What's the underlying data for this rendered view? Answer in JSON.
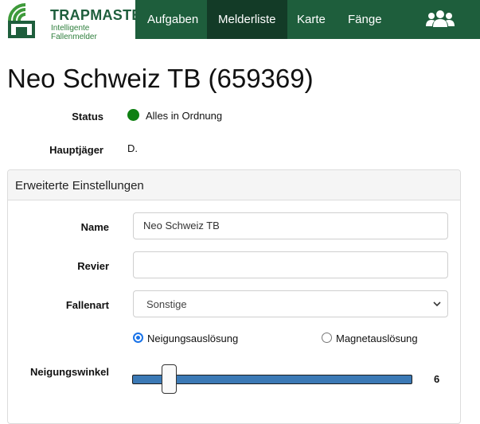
{
  "brand": {
    "name": "TRAPMASTER",
    "tagline": "Intelligente Fallenmelder"
  },
  "nav": {
    "items": [
      "Aufgaben",
      "Melderliste",
      "Karte",
      "Fänge"
    ],
    "active": "Melderliste"
  },
  "page": {
    "title": "Neo Schweiz TB (659369)"
  },
  "info": {
    "status_label": "Status",
    "status_value": "Alles in Ordnung",
    "status_color": "#0e8012",
    "hunter_label": "Hauptjäger",
    "hunter_value": "D."
  },
  "panel": {
    "title": "Erweiterte Einstellungen",
    "name_label": "Name",
    "name_value": "Neo Schweiz TB",
    "revier_label": "Revier",
    "revier_value": "",
    "fallenart_label": "Fallenart",
    "fallenart_value": "Sonstige",
    "trigger_options": [
      "Neigungsauslösung",
      "Magnetauslösung"
    ],
    "trigger_selected": "Neigungsauslösung",
    "angle_label": "Neigungswinkel",
    "angle_value": "6"
  },
  "colors": {
    "nav_bg": "#1e5e3c",
    "nav_active": "#133b27",
    "accent": "#1a73e8",
    "slider": "#3b79b5"
  }
}
